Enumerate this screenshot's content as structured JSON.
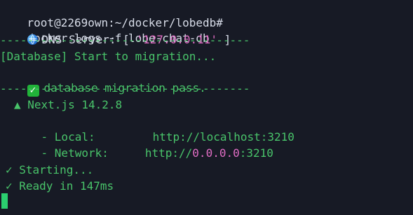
{
  "prompt": {
    "user_host_path": "root@2269own:~/docker/lobedb#",
    "command": "docker logs -f lobe-chat-db"
  },
  "dns": {
    "icon": "globe-icon",
    "label": "DNS Server: [",
    "value": "'127.0.0.11'",
    "end": "]"
  },
  "separators": {
    "line1": "-------------------------------------",
    "line2": "-------------------------------------"
  },
  "database": {
    "start": "[Database] Start to migration...",
    "pass_icon": "check-box-icon",
    "pass_text": "database migration pass."
  },
  "nextjs": {
    "brand_line": "▲ Next.js 14.2.8",
    "local_label": "- Local:",
    "local_url": "http://localhost:3210",
    "network_label": "- Network:",
    "network_prefix": "http://",
    "network_host": "0.0.0.0",
    "network_port": ":3210"
  },
  "status": {
    "starting": "✓ Starting...",
    "ready": "✓ Ready in 147ms"
  },
  "colors": {
    "background": "#171a25",
    "green": "#49c46a",
    "pink": "#e06dc4",
    "cursor": "#2bcf6f"
  }
}
